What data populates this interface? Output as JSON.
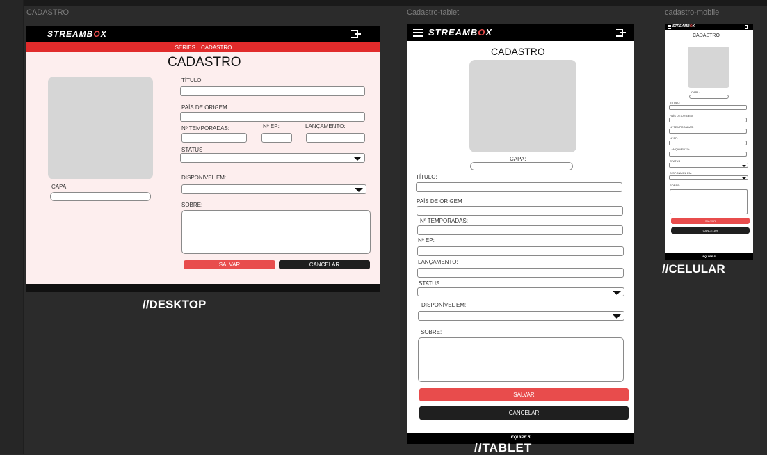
{
  "frames": {
    "desktop_label": "CADASTRO",
    "tablet_label": "Cadastro-tablet",
    "mobile_label": "cadastro-mobile"
  },
  "brand": {
    "prefix": "STREAMB",
    "o": "O",
    "suffix": "X"
  },
  "nav": {
    "series": "SÉRIES",
    "cadastro": "CADASTRO"
  },
  "form": {
    "title": "CADASTRO",
    "titulo": "TÍTULO:",
    "pais": "PAÍS DE ORIGEM",
    "temporadas": "Nº TEMPORADAS:",
    "ep": "Nº EP:",
    "lancamento": "LANÇAMENTO:",
    "status": "STATUS",
    "disponivel": "DISPONÍVEL EM:",
    "sobre": "SOBRE:",
    "capa": "CAPA:",
    "salvar": "SALVAR",
    "cancelar": "CANCELAR"
  },
  "footer": {
    "team": "EQUIPE 5"
  },
  "captions": {
    "desktop": "//DESKTOP",
    "tablet": "//TABLET",
    "mobile": "//CELULAR"
  },
  "colors": {
    "accent": "#e84c4c",
    "dark": "#1f1f1f",
    "desktop_bg": "#fdeeee"
  }
}
